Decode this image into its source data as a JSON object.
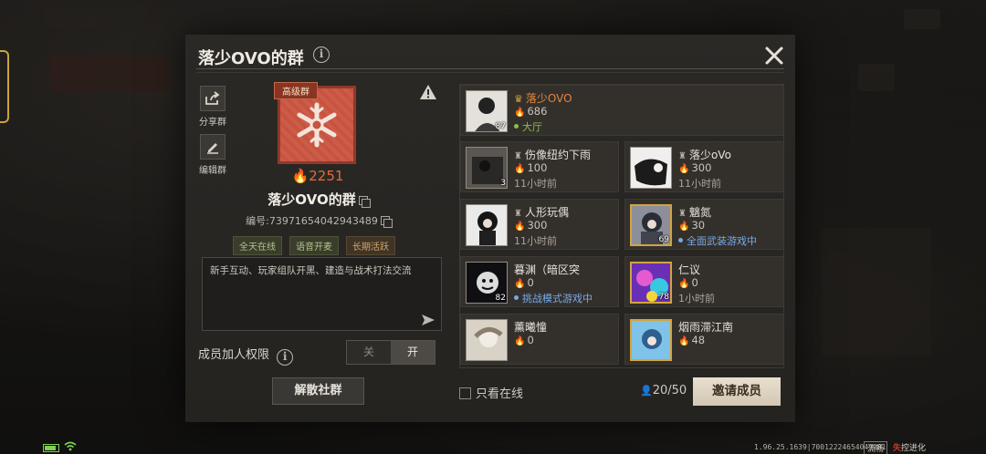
{
  "dialog": {
    "title": "落少OVO的群",
    "close_icon": "close-icon"
  },
  "sidebar": {
    "share_label": "分享群",
    "edit_label": "编辑群"
  },
  "group": {
    "tier_badge": "高级群",
    "heat": "2251",
    "name": "落少OVO的群",
    "id_text": "编号:73971654042943489",
    "tags": [
      "全天在线",
      "语音开麦",
      "长期活跃"
    ],
    "description": "新手互动、玩家组队开黑、建造与战术打法交流"
  },
  "permission": {
    "label": "成员加人权限",
    "off_label": "关",
    "on_label": "开",
    "selected": "开"
  },
  "disband_label": "解散社群",
  "members": [
    {
      "name": "落少OVO",
      "heat": "686",
      "status": "大厅",
      "level": "87",
      "leader": true,
      "status_type": "green"
    },
    {
      "name": "伤像纽约下雨",
      "heat": "100",
      "status": "11小时前",
      "level": "3",
      "status_type": "time"
    },
    {
      "name": "落少oVo",
      "heat": "300",
      "status": "11小时前",
      "level": "",
      "status_type": "time"
    },
    {
      "name": "人形玩偶",
      "heat": "300",
      "status": "11小时前",
      "level": "",
      "status_type": "time"
    },
    {
      "name": "魑氮",
      "heat": "30",
      "status": "全面武装游戏中",
      "level": "69",
      "status_type": "blue"
    },
    {
      "name": "暮渊（暗区突",
      "heat": "0",
      "status": "挑战模式游戏中",
      "level": "82",
      "status_type": "blue"
    },
    {
      "name": "仁议",
      "heat": "0",
      "status": "1小时前",
      "level": "78",
      "status_type": "time"
    },
    {
      "name": "薰曦憧",
      "heat": "0",
      "status": "",
      "level": "",
      "status_type": "time"
    },
    {
      "name": "烟雨滞江南",
      "heat": "48",
      "status": "",
      "level": "",
      "status_type": "time"
    }
  ],
  "footer": {
    "online_only_label": "只看在线",
    "member_count": "20/50",
    "invite_label": "邀请成员"
  },
  "system": {
    "version": "1.96.25.1639|70012224654049281",
    "fluency": "流畅",
    "brand_a": "失",
    "brand_b": "控进化"
  },
  "colors": {
    "accent_orange": "#e26d3a",
    "online_green": "#86c04a",
    "ingame_blue": "#78a9e8",
    "invite_bg": "#e9dfcf"
  }
}
